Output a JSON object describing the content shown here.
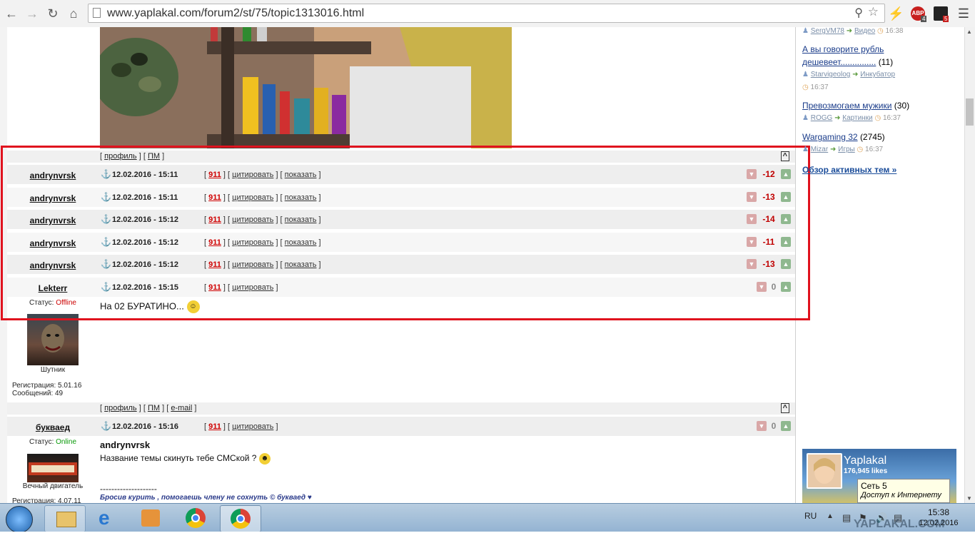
{
  "browser": {
    "url": "www.yaplakal.com/forum2/st/75/topic1313016.html",
    "ext_abp_label": "ABP",
    "ext_abp_count": "4",
    "ext_other_count": "5"
  },
  "posts_bar_top": {
    "profile": "профиль",
    "pm": "ПМ",
    "to_top": "^"
  },
  "posts": [
    {
      "user": "andrynvrsk",
      "datetime": "12.02.2016 - 15:11",
      "n911": "911",
      "quote": "цитировать",
      "show": "показать",
      "score": "-12"
    },
    {
      "user": "andrynvrsk",
      "datetime": "12.02.2016 - 15:11",
      "n911": "911",
      "quote": "цитировать",
      "show": "показать",
      "score": "-13"
    },
    {
      "user": "andrynvrsk",
      "datetime": "12.02.2016 - 15:12",
      "n911": "911",
      "quote": "цитировать",
      "show": "показать",
      "score": "-14"
    },
    {
      "user": "andrynvrsk",
      "datetime": "12.02.2016 - 15:12",
      "n911": "911",
      "quote": "цитировать",
      "show": "показать",
      "score": "-11"
    },
    {
      "user": "andrynvrsk",
      "datetime": "12.02.2016 - 15:12",
      "n911": "911",
      "quote": "цитировать",
      "show": "показать",
      "score": "-13"
    }
  ],
  "lekterr_post": {
    "user": "Lekterr",
    "datetime": "12.02.2016 - 15:15",
    "n911": "911",
    "quote": "цитировать",
    "score": "0",
    "status_label": "Статус:",
    "status_value": "Offline",
    "body": "На 02 БУРАТИНО...",
    "rank": "Шутник",
    "registered": "Регистрация: 5.01.16",
    "messages": "Сообщений: 49"
  },
  "bukvaed_bar": {
    "profile": "профиль",
    "pm": "ПМ",
    "email": "e-mail",
    "to_top": "^"
  },
  "bukvaed_post": {
    "user": "букваед",
    "datetime": "12.02.2016 - 15:16",
    "n911": "911",
    "quote": "цитировать",
    "score": "0",
    "status_label": "Статус:",
    "status_value": "Online",
    "quoted_user": "andrynvrsk",
    "body": "Название темы скинуть тебе СМСкой ?",
    "rank": "Вечный двигатель",
    "registered": "Регистрация: 4.07.11",
    "separator": "--------------------",
    "signature": "Бросив курить , помогаешь члену не сохнуть © букваед ♥"
  },
  "sidebar": {
    "item0_meta": {
      "user": "SergVM78",
      "cat": "Видео",
      "time": "16:38"
    },
    "topics": [
      {
        "title_line1": "А вы говорите рубль",
        "title_line2": "дешевеет...............",
        "count": "(11)",
        "user": "Starvigeolog",
        "cat": "Инкубатор",
        "time": "16:37"
      },
      {
        "title_line1": "Превозмогаем мужики",
        "title_line2": "",
        "count": "(30)",
        "user": "ROGG",
        "cat": "Картинки",
        "time": "16:37"
      },
      {
        "title_line1": "Wargaming 32",
        "title_line2": "",
        "count": "(2745)",
        "user": "Mizar",
        "cat": "Игры",
        "time": "16:37"
      }
    ],
    "overview": "Обзор активных тем »",
    "fb_name": "Yaplakal",
    "fb_likes": "176,945 likes",
    "tooltip_line1": "Сеть  5",
    "tooltip_line2": "Доступ к Интернету"
  },
  "taskbar": {
    "lang": "RU",
    "time": "15:38",
    "date": "12.02.2016",
    "watermark": "YAPLAKAL.COM"
  }
}
